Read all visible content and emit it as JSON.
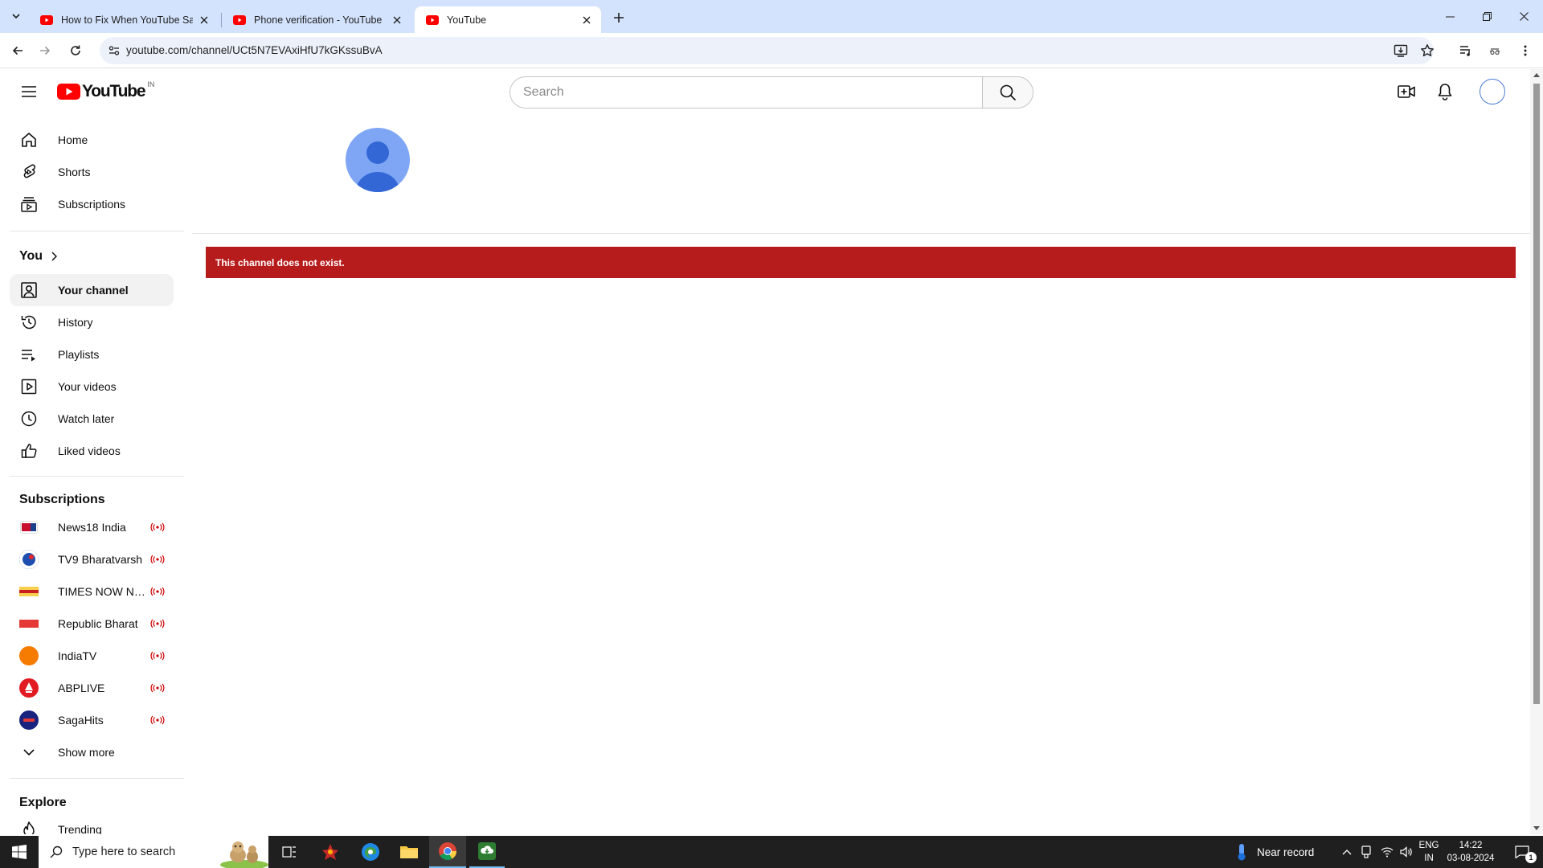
{
  "browser": {
    "tabs": [
      {
        "title": "How to Fix When YouTube Says"
      },
      {
        "title": "Phone verification - YouTube"
      },
      {
        "title": "YouTube"
      }
    ],
    "url": "youtube.com/channel/UCt5N7EVAxiHfU7kGKssuBvA"
  },
  "masthead": {
    "logo_text": "YouTube",
    "country_code": "IN",
    "search_placeholder": "Search"
  },
  "sidebar": {
    "main": [
      {
        "label": "Home",
        "icon": "home-icon"
      },
      {
        "label": "Shorts",
        "icon": "shorts-icon"
      },
      {
        "label": "Subscriptions",
        "icon": "subscriptions-icon"
      }
    ],
    "you_title": "You",
    "you": [
      {
        "label": "Your channel",
        "icon": "your-channel-icon",
        "selected": true
      },
      {
        "label": "History",
        "icon": "history-icon"
      },
      {
        "label": "Playlists",
        "icon": "playlists-icon"
      },
      {
        "label": "Your videos",
        "icon": "your-videos-icon"
      },
      {
        "label": "Watch later",
        "icon": "watch-later-icon"
      },
      {
        "label": "Liked videos",
        "icon": "liked-videos-icon"
      }
    ],
    "subscriptions_title": "Subscriptions",
    "subscriptions": [
      {
        "label": "News18 India",
        "live": true
      },
      {
        "label": "TV9 Bharatvarsh",
        "live": true
      },
      {
        "label": "TIMES NOW Navbharat",
        "live": true
      },
      {
        "label": "Republic Bharat",
        "live": true
      },
      {
        "label": "IndiaTV",
        "live": true
      },
      {
        "label": "ABPLIVE",
        "live": true
      },
      {
        "label": "SagaHits",
        "live": true
      }
    ],
    "show_more": "Show more",
    "explore_title": "Explore",
    "explore": [
      {
        "label": "Trending",
        "icon": "trending-icon"
      }
    ]
  },
  "main": {
    "error_message": "This channel does not exist."
  },
  "taskbar": {
    "search_placeholder": "Type here to search",
    "weather": "Near record",
    "lang_line1": "ENG",
    "lang_line2": "IN",
    "time": "14:22",
    "date": "03-08-2024",
    "notification_count": "1"
  },
  "colors": {
    "youtube_red": "#ff0000",
    "error_bar": "#b71c1c",
    "tabstrip": "#d3e3fd",
    "avatar_blue": "#7ea6f4"
  }
}
